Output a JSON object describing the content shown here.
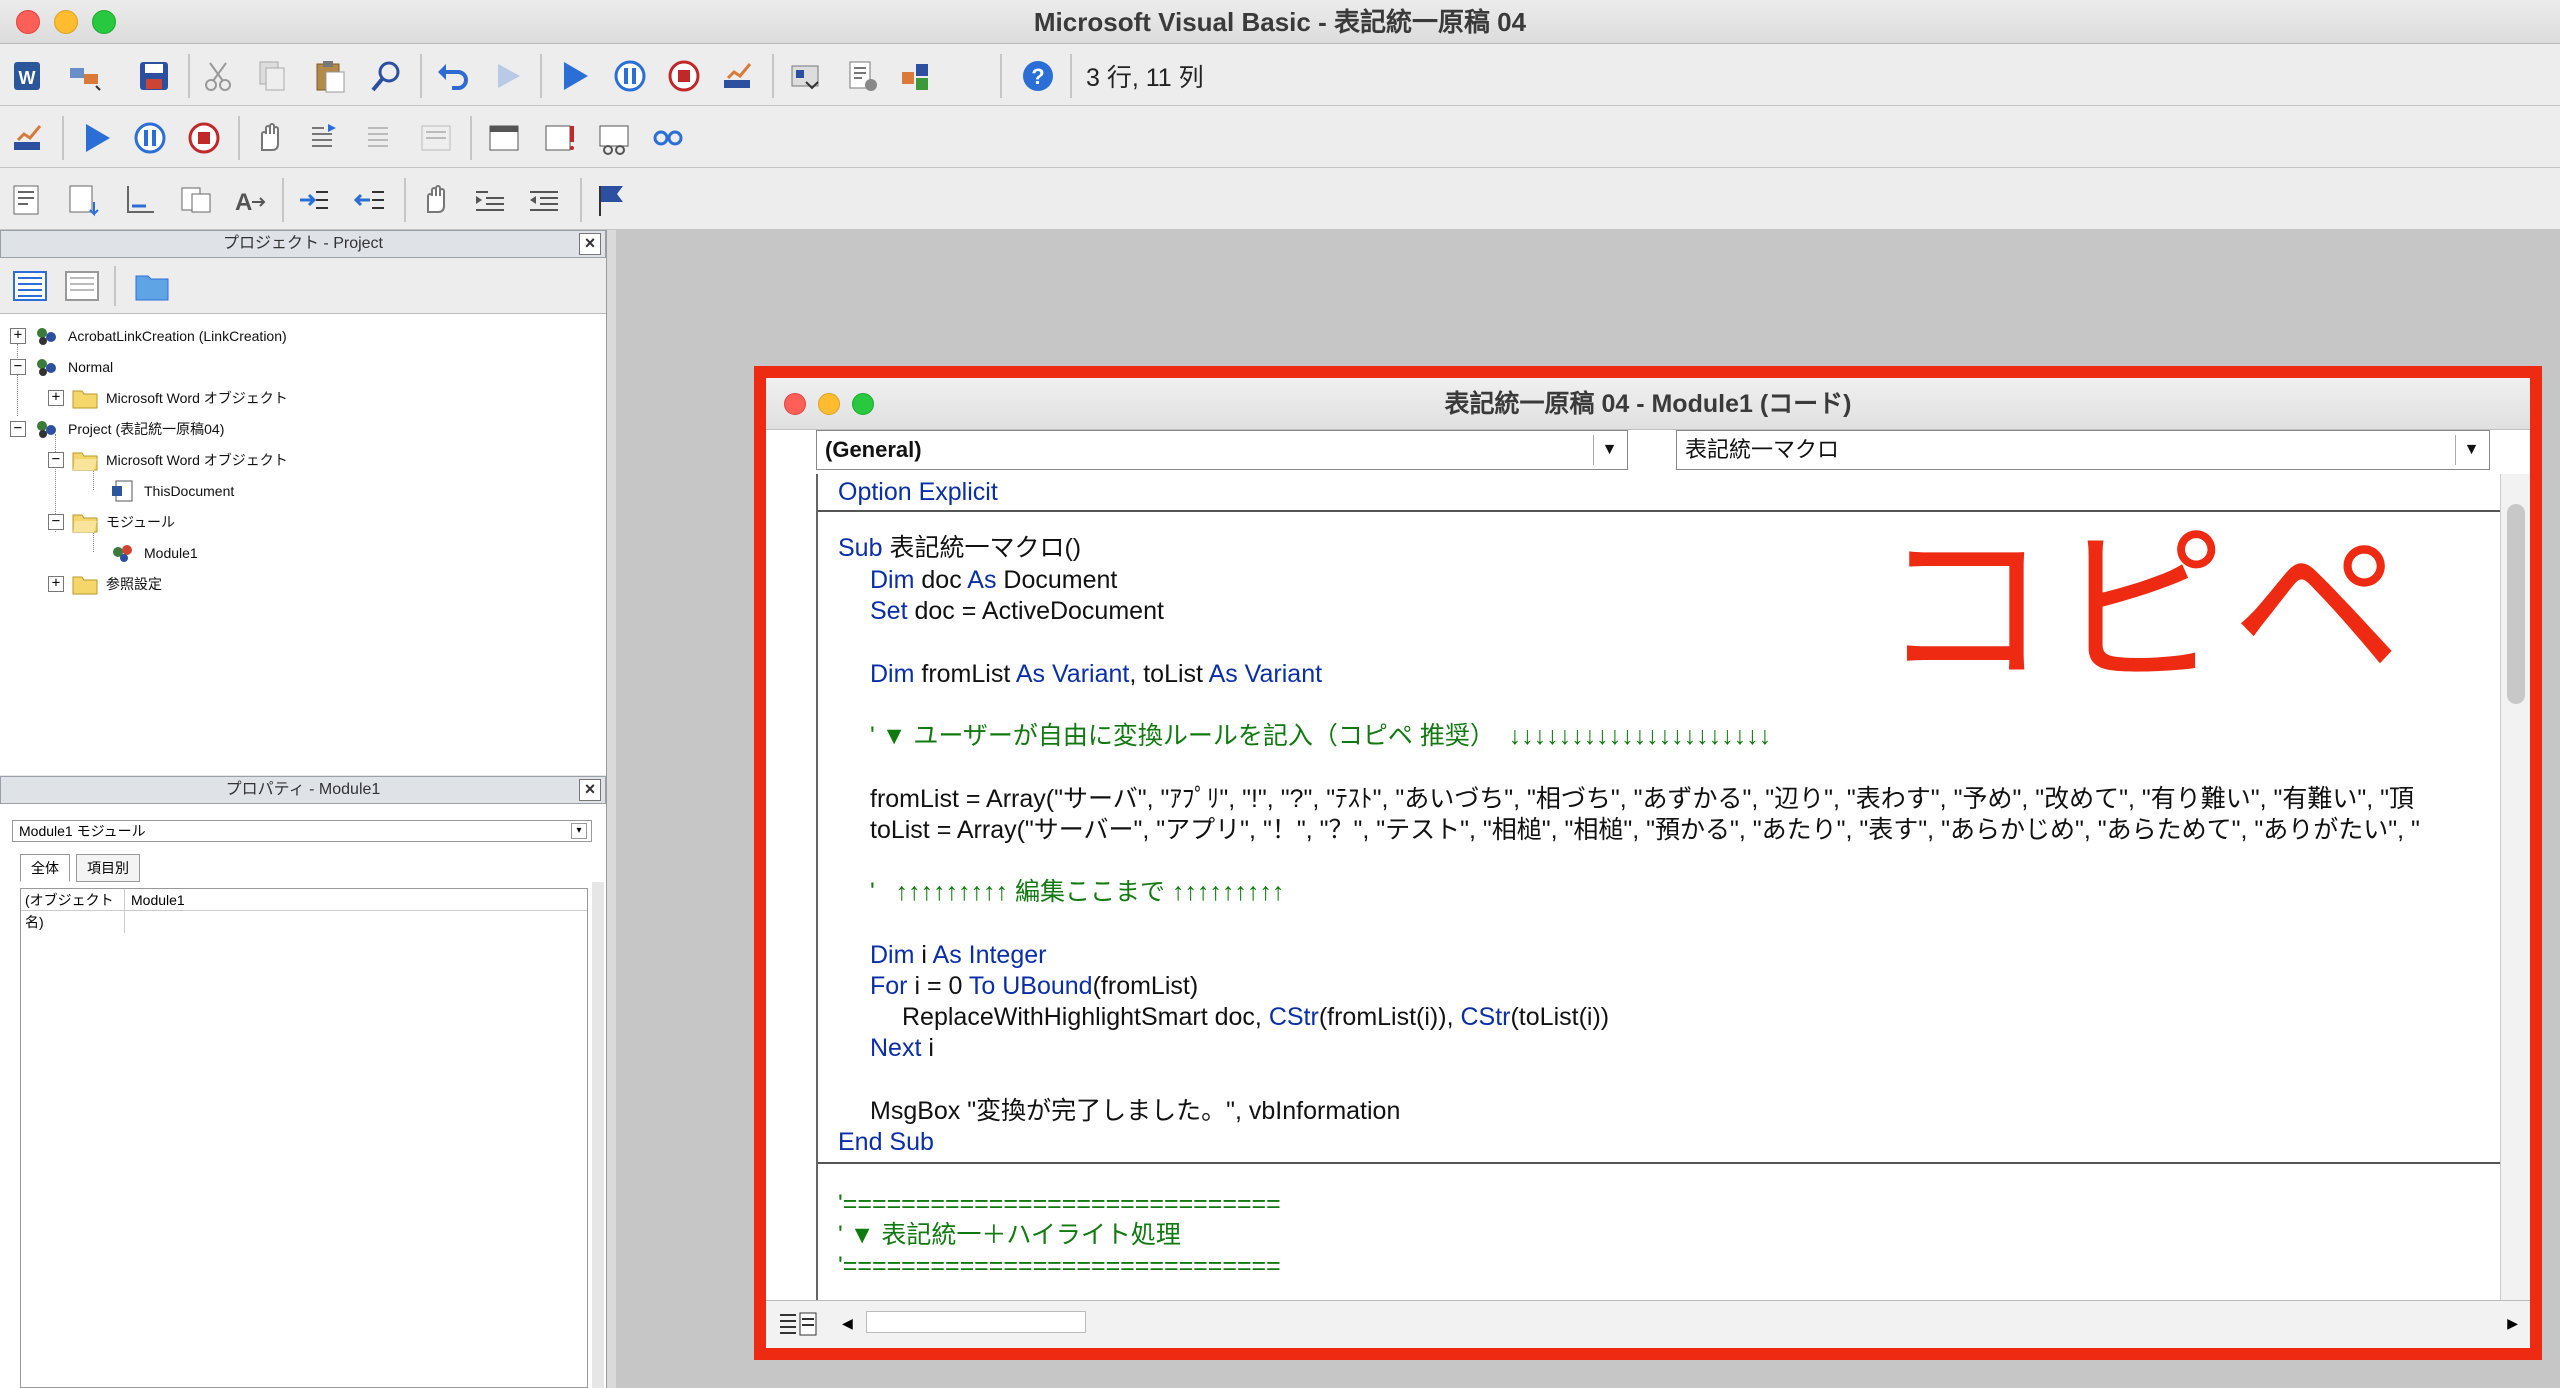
{
  "window": {
    "title": "Microsoft Visual Basic - 表記統一原稿 04",
    "cursor_position": "3 行, 11 列"
  },
  "colors": {
    "highlight": "#ee2a12",
    "keyword": "#0a2ea8",
    "comment": "#107a10",
    "close_button": "#fe5f57",
    "minimize_button": "#febc2e",
    "zoom_button": "#28c840"
  },
  "toolbar1": {
    "icons": [
      "word-icon",
      "design-icon",
      "save-icon",
      "cut-icon",
      "copy-icon",
      "paste-icon",
      "find-icon",
      "undo-icon",
      "redo-icon",
      "run-icon",
      "pause-icon",
      "stop-icon",
      "design-mode-icon",
      "project-explorer-icon",
      "properties-icon",
      "toolbox-icon",
      "help-icon"
    ]
  },
  "project_pane": {
    "title": "プロジェクト - Project",
    "close": "×",
    "tree": [
      {
        "label": "AcrobatLinkCreation (LinkCreation)",
        "expander": "+"
      },
      {
        "label": "Normal",
        "expander": "−"
      },
      {
        "label": "Microsoft Word オブジェクト",
        "expander": "+"
      },
      {
        "label": "Project (表記統一原稿04)",
        "expander": "−"
      },
      {
        "label": "Microsoft Word オブジェクト",
        "expander": "−"
      },
      {
        "label": "ThisDocument",
        "expander": ""
      },
      {
        "label": "モジュール",
        "expander": "−"
      },
      {
        "label": "Module1",
        "expander": ""
      },
      {
        "label": "参照設定",
        "expander": "+"
      }
    ]
  },
  "properties_pane": {
    "title": "プロパティ - Module1",
    "close": "×",
    "object_combo": "Module1  モジュール",
    "tabs": [
      "全体",
      "項目別"
    ],
    "rows": [
      {
        "key": "(オブジェクト名)",
        "value": "Module1"
      }
    ]
  },
  "code_window": {
    "title": "表記統一原稿 04 - Module1 (コード)",
    "object_combo": "(General)",
    "procedure_combo": "表記統一マクロ",
    "lines": {
      "l1_kw": "Option Explicit",
      "l2_kw": "Sub ",
      "l2_rest": "表記統一マクロ()",
      "l3_kw": "Dim",
      "l3_a": " doc ",
      "l3_kw2": "As",
      "l3_b": " Document",
      "l4_kw": "Set",
      "l4_rest": " doc = ActiveDocument",
      "l5_kw": "Dim",
      "l5_a": " fromList ",
      "l5_kw2": "As Variant",
      "l5_b": ", toList ",
      "l5_kw3": "As Variant",
      "l6_cm": "' ▼ ユーザーが自由に変換ルールを記入（コピペ 推奨）  ↓↓↓↓↓↓↓↓↓↓↓↓↓↓↓↓↓↓↓↓↓",
      "l7": "fromList = Array(\"サーバ\", \"ｱﾌﾟﾘ\", \"!\", \"?\", \"ﾃｽﾄ\", \"あいづち\", \"相づち\", \"あずかる\", \"辺り\", \"表わす\", \"予め\", \"改めて\", \"有り難い\", \"有難い\", \"頂",
      "l8": "toList = Array(\"サーバー\", \"アプリ\", \"！\", \"？\", \"テスト\", \"相槌\", \"相槌\", \"預かる\", \"あたり\", \"表す\", \"あらかじめ\", \"あらためて\", \"ありがたい\", \"",
      "l9_cm": "'   ↑↑↑↑↑↑↑↑↑ 編集ここまで ↑↑↑↑↑↑↑↑↑",
      "l10_kw": "Dim",
      "l10_a": " i ",
      "l10_kw2": "As Integer",
      "l11_kw": "For",
      "l11_a": " i = 0 ",
      "l11_kw2": "To UBound",
      "l11_b": "(fromList)",
      "l12_a": "ReplaceWithHighlightSmart doc, ",
      "l12_kw": "CStr",
      "l12_b": "(fromList(i)), ",
      "l12_kw2": "CStr",
      "l12_c": "(toList(i))",
      "l13_kw": "Next",
      "l13_a": " i",
      "l14": "MsgBox \"変換が完了しました。\", vbInformation",
      "l15_kw": "End Sub",
      "l16_cm": "'==============================",
      "l17_cm": "' ▼ 表記統一＋ハイライト処理",
      "l18_cm": "'=============================="
    }
  },
  "annotation": {
    "text": "コピペ"
  }
}
